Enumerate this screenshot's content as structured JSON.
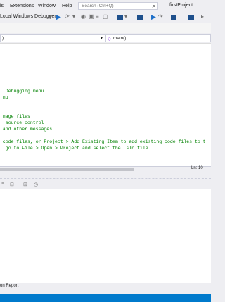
{
  "menu": {
    "items": [
      "ls",
      "Extensions",
      "Window",
      "Help"
    ],
    "search_placeholder": "Search (Ctrl+Q)",
    "project_title": "firstProject"
  },
  "toolbar": {
    "debugger_label": "Local Windows Debugger"
  },
  "nav": {
    "left_value": ")",
    "right_value": "main()"
  },
  "editor": {
    "lines": [
      "  Debugging menu",
      " nu",
      "",
      "",
      " nage files",
      "  source control",
      " and other messages",
      "",
      "",
      " code files, or Project > Add Existing Item to add existing code files to t",
      "  go to File > Open > Project and select the .sln file"
    ]
  },
  "status": {
    "line": "Ln: 10"
  },
  "bottom": {
    "error_list_label": "on Report"
  },
  "colors": {
    "accent": "#007acc",
    "comment": "#008000"
  }
}
